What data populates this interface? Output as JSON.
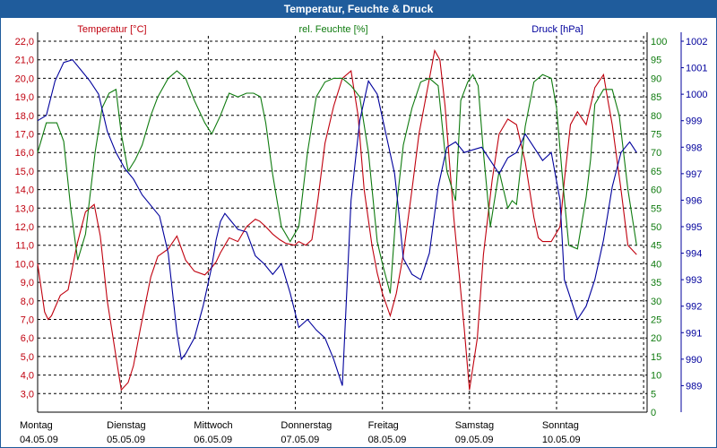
{
  "window": {
    "title": "Temperatur, Feuchte & Druck"
  },
  "colors": {
    "temperature": "#c0000e",
    "humidity": "#0f7b0f",
    "pressure": "#00009c",
    "title_bar": "#1f5c9c",
    "grid": "#000000"
  },
  "chart_data": {
    "type": "line",
    "title": "Temperatur, Feuchte & Druck",
    "grid": true,
    "xlim": [
      0,
      7
    ],
    "x_ticks": [
      {
        "day": "Montag",
        "date": "04.05.09"
      },
      {
        "day": "Dienstag",
        "date": "05.05.09"
      },
      {
        "day": "Mittwoch",
        "date": "06.05.09"
      },
      {
        "day": "Donnerstag",
        "date": "07.05.09"
      },
      {
        "day": "Freitag",
        "date": "08.05.09"
      },
      {
        "day": "Samstag",
        "date": "09.05.09"
      },
      {
        "day": "Sonntag",
        "date": "10.05.09"
      }
    ],
    "axes": {
      "temperature": {
        "label": "Temperatur [°C]",
        "ylim": [
          2.0,
          22.0
        ],
        "ticks": [
          "3,0",
          "4,0",
          "5,0",
          "6,0",
          "7,0",
          "8,0",
          "9,0",
          "10,0",
          "11,0",
          "12,0",
          "13,0",
          "14,0",
          "15,0",
          "16,0",
          "17,0",
          "18,0",
          "19,0",
          "20,0",
          "21,0",
          "22,0"
        ]
      },
      "humidity": {
        "label": "rel. Feuchte [%]",
        "ylim": [
          0,
          100
        ],
        "ticks": [
          "0",
          "5",
          "10",
          "15",
          "20",
          "25",
          "30",
          "35",
          "40",
          "45",
          "50",
          "55",
          "60",
          "65",
          "70",
          "75",
          "80",
          "85",
          "90",
          "95",
          "100"
        ]
      },
      "pressure": {
        "label": "Druck [hPa]",
        "ylim": [
          988,
          1002
        ],
        "ticks": [
          "989",
          "990",
          "991",
          "992",
          "993",
          "994",
          "995",
          "996",
          "997",
          "998",
          "999",
          "1000",
          "1001",
          "1002"
        ]
      }
    },
    "series": [
      {
        "name": "Temperatur [°C]",
        "axis": "temperature",
        "x": [
          0,
          0.08,
          0.12,
          0.16,
          0.26,
          0.35,
          0.45,
          0.55,
          0.65,
          0.72,
          0.8,
          0.9,
          0.96,
          1.04,
          1.1,
          1.18,
          1.3,
          1.38,
          1.5,
          1.6,
          1.7,
          1.8,
          1.92,
          2.0,
          2.05,
          2.1,
          2.2,
          2.3,
          2.4,
          2.5,
          2.55,
          2.62,
          2.7,
          2.78,
          2.85,
          2.95,
          3.0,
          3.08,
          3.15,
          3.22,
          3.3,
          3.4,
          3.5,
          3.6,
          3.68,
          3.75,
          3.84,
          3.9,
          3.96,
          4.05,
          4.12,
          4.2,
          4.3,
          4.38,
          4.48,
          4.56,
          4.62,
          4.68,
          4.78,
          4.84,
          4.9,
          4.96,
          5.05,
          5.12,
          5.22,
          5.3,
          5.4,
          5.5,
          5.6,
          5.7,
          5.75,
          5.8,
          5.9,
          6.0,
          6.05,
          6.12,
          6.2,
          6.3,
          6.4,
          6.5,
          6.55,
          6.6,
          6.7,
          6.78,
          6.88
        ],
        "y": [
          10.0,
          7.4,
          7.0,
          7.2,
          8.3,
          8.6,
          11.0,
          12.8,
          13.2,
          11.5,
          8.0,
          5.0,
          3.2,
          3.6,
          4.5,
          6.5,
          9.3,
          10.4,
          10.8,
          11.5,
          10.2,
          9.6,
          9.4,
          9.8,
          10.1,
          10.6,
          11.4,
          11.2,
          12.0,
          12.4,
          12.3,
          12.0,
          11.6,
          11.3,
          11.1,
          11.0,
          11.2,
          11.0,
          11.3,
          13.5,
          16.5,
          18.5,
          20.0,
          20.4,
          18.0,
          14.0,
          11.0,
          9.5,
          8.4,
          7.2,
          8.4,
          10.5,
          14.0,
          17.0,
          19.5,
          21.5,
          21.0,
          18.5,
          12.5,
          9.5,
          6.5,
          3.2,
          6.0,
          10.5,
          14.5,
          17.0,
          17.8,
          17.5,
          15.5,
          12.5,
          11.4,
          11.2,
          11.2,
          12.0,
          14.5,
          17.5,
          18.2,
          17.5,
          19.5,
          20.2,
          18.8,
          17.5,
          14.0,
          11.0,
          10.5
        ]
      },
      {
        "name": "rel. Feuchte [%]",
        "axis": "humidity",
        "x": [
          0,
          0.1,
          0.22,
          0.3,
          0.38,
          0.46,
          0.55,
          0.66,
          0.74,
          0.82,
          0.9,
          0.96,
          1.04,
          1.12,
          1.2,
          1.3,
          1.38,
          1.5,
          1.6,
          1.7,
          1.8,
          1.92,
          2.0,
          2.1,
          2.2,
          2.3,
          2.4,
          2.48,
          2.56,
          2.62,
          2.7,
          2.8,
          2.9,
          3.0,
          3.1,
          3.2,
          3.3,
          3.4,
          3.5,
          3.6,
          3.7,
          3.8,
          3.9,
          3.96,
          4.05,
          4.12,
          4.2,
          4.3,
          4.4,
          4.5,
          4.6,
          4.7,
          4.8,
          4.86,
          4.94,
          5.0,
          5.06,
          5.12,
          5.2,
          5.3,
          5.4,
          5.45,
          5.5,
          5.6,
          5.7,
          5.8,
          5.9,
          5.96,
          6.04,
          6.1,
          6.2,
          6.3,
          6.35,
          6.4,
          6.5,
          6.6,
          6.68,
          6.78,
          6.88
        ],
        "y": [
          70,
          78,
          78,
          73,
          55,
          41,
          48,
          70,
          82,
          86,
          87,
          75,
          65,
          68,
          72,
          80,
          85,
          90,
          92,
          90,
          84,
          78,
          75,
          80,
          86,
          85,
          86,
          86,
          85,
          78,
          64,
          50,
          46,
          50,
          70,
          85,
          89,
          90,
          90,
          88,
          85,
          70,
          46,
          40,
          32,
          55,
          72,
          82,
          89,
          90,
          88,
          65,
          57,
          84,
          89,
          91,
          88,
          70,
          50,
          65,
          55,
          57,
          56,
          77,
          89,
          91,
          90,
          82,
          60,
          45,
          44,
          58,
          68,
          83,
          87,
          87,
          80,
          60,
          45
        ]
      },
      {
        "name": "Druck [hPa]",
        "axis": "pressure",
        "x": [
          0,
          0.1,
          0.2,
          0.3,
          0.4,
          0.5,
          0.6,
          0.7,
          0.8,
          0.9,
          1.0,
          1.1,
          1.2,
          1.3,
          1.4,
          1.5,
          1.6,
          1.65,
          1.7,
          1.8,
          1.9,
          2.0,
          2.05,
          2.1,
          2.15,
          2.2,
          2.3,
          2.4,
          2.5,
          2.6,
          2.7,
          2.8,
          2.9,
          3.0,
          3.1,
          3.2,
          3.3,
          3.4,
          3.5,
          3.6,
          3.7,
          3.8,
          3.9,
          4.0,
          4.1,
          4.15,
          4.2,
          4.25,
          4.3,
          4.4,
          4.5,
          4.6,
          4.7,
          4.8,
          4.9,
          5.0,
          5.1,
          5.2,
          5.3,
          5.4,
          5.5,
          5.6,
          5.7,
          5.8,
          5.9,
          6.0,
          6.05,
          6.1,
          6.15,
          6.2,
          6.3,
          6.4,
          6.5,
          6.6,
          6.7,
          6.8,
          6.88
        ],
        "y": [
          999.0,
          999.2,
          1000.5,
          1001.2,
          1001.3,
          1000.9,
          1000.5,
          1000.0,
          998.6,
          997.8,
          997.2,
          996.8,
          996.2,
          995.8,
          995.4,
          994.0,
          991.0,
          990.0,
          990.2,
          990.8,
          992.0,
          993.5,
          994.5,
          995.2,
          995.5,
          995.3,
          994.9,
          994.8,
          993.9,
          993.6,
          993.2,
          993.6,
          992.5,
          991.2,
          991.5,
          991.1,
          990.8,
          990.0,
          989.0,
          996.0,
          999.0,
          1000.5,
          1000.0,
          998.5,
          997.0,
          995.5,
          993.8,
          993.5,
          993.2,
          993.0,
          994.0,
          996.5,
          998.0,
          998.2,
          997.8,
          997.9,
          998.0,
          997.5,
          997.0,
          997.6,
          997.8,
          998.5,
          998.0,
          997.5,
          997.8,
          996.0,
          993.0,
          992.5,
          992.0,
          991.5,
          992.0,
          993.0,
          994.5,
          996.5,
          997.8,
          998.2,
          997.8
        ]
      }
    ]
  }
}
